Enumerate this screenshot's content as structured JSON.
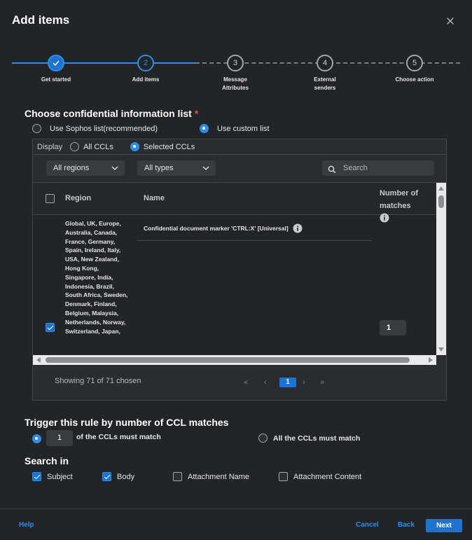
{
  "dialog": {
    "title": "Add items",
    "close_icon": "close-icon"
  },
  "stepper": {
    "steps": [
      {
        "number": "1",
        "label": "Get started",
        "state": "done"
      },
      {
        "number": "2",
        "label": "Add items",
        "state": "active"
      },
      {
        "number": "3",
        "label": "Message Attributes",
        "state": "todo"
      },
      {
        "number": "4",
        "label": "External senders",
        "state": "todo"
      },
      {
        "number": "5",
        "label": "Choose action",
        "state": "todo"
      }
    ]
  },
  "ccl_section": {
    "title": "Choose confidential information list",
    "required_mark": "*",
    "option_sophos": "Use Sophos list(recommended)",
    "option_custom": "Use custom list",
    "selected": "custom"
  },
  "panel": {
    "display_label": "Display",
    "display_all": "All CCLs",
    "display_selected": "Selected CCLs",
    "regions_dropdown": "All regions",
    "types_dropdown": "All types",
    "search_placeholder": "Search",
    "columns": {
      "region": "Region",
      "name": "Name",
      "matches": "Number of matches"
    },
    "rows": [
      {
        "checked": true,
        "region": "Global, UK, Europe, Australia, Canada, France, Germany, Spain, Ireland, Italy, USA, New Zealand, Hong Kong, Singapore, India, Indonesia, Brazil, South Africa, Sweden, Denmark, Finland, Belgium, Malaysia, Netherlands, Norway, Switzerland, Japan,",
        "name": "Confidential document marker 'CTRL:X' [Universal]",
        "matches": "1"
      }
    ],
    "pager": {
      "summary": "Showing 71 of 71 chosen",
      "current_page": "1",
      "first": "«",
      "prev": "‹",
      "next": "›",
      "last": "»"
    }
  },
  "trigger": {
    "title": "Trigger this rule by number of CCL matches",
    "count_value": "1",
    "option_count_label": "of the CCLs must match",
    "option_all_label": "All the CCLs must match",
    "selected": "count"
  },
  "search_in": {
    "title": "Search in",
    "options": [
      {
        "label": "Subject",
        "checked": true
      },
      {
        "label": "Body",
        "checked": true
      },
      {
        "label": "Attachment Name",
        "checked": false
      },
      {
        "label": "Attachment Content",
        "checked": false
      }
    ]
  },
  "footer": {
    "help": "Help",
    "cancel": "Cancel",
    "back": "Back",
    "next": "Next"
  },
  "colors": {
    "accent": "#1f73d0",
    "accent_light": "#2d8ee6",
    "background": "#232427",
    "required": "#e04f3a"
  }
}
